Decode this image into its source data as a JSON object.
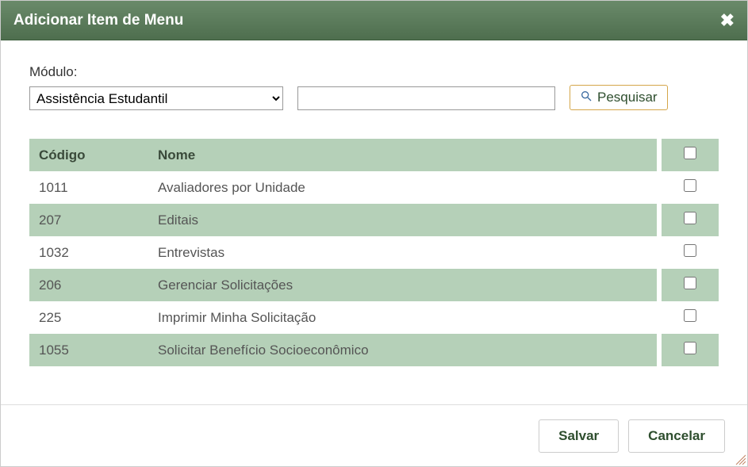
{
  "modal": {
    "title": "Adicionar Item de Menu",
    "close_title": "Fechar"
  },
  "form": {
    "modulo_label": "Módulo:",
    "modulo_selected": "Assistência Estudantil",
    "search_value": "",
    "search_placeholder": "",
    "pesquisar_label": "Pesquisar"
  },
  "table": {
    "headers": {
      "codigo": "Código",
      "nome": "Nome"
    },
    "rows": [
      {
        "codigo": "1011",
        "nome": "Avaliadores por Unidade",
        "checked": false
      },
      {
        "codigo": "207",
        "nome": "Editais",
        "checked": false
      },
      {
        "codigo": "1032",
        "nome": "Entrevistas",
        "checked": false
      },
      {
        "codigo": "206",
        "nome": "Gerenciar Solicitações",
        "checked": false
      },
      {
        "codigo": "225",
        "nome": "Imprimir Minha Solicitação",
        "checked": false
      },
      {
        "codigo": "1055",
        "nome": "Solicitar Benefício Socioeconômico",
        "checked": false
      }
    ],
    "select_all_checked": false
  },
  "buttons": {
    "salvar": "Salvar",
    "cancelar": "Cancelar"
  }
}
